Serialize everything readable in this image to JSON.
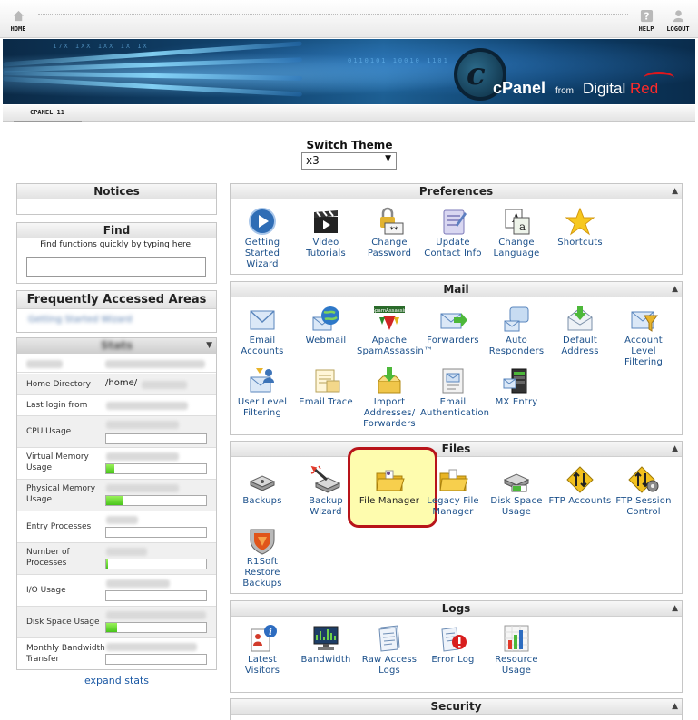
{
  "topnav": {
    "home": "HOME",
    "help": "HELP",
    "logout": "LOGOUT"
  },
  "banner": {
    "brand": "cPanel",
    "from": "from",
    "company_a": "Digital ",
    "company_b": "Red"
  },
  "subbar": {
    "label": "CPANEL 11"
  },
  "theme": {
    "label": "Switch Theme",
    "selected": "x3"
  },
  "notices": {
    "title": "Notices"
  },
  "find": {
    "title": "Find",
    "hint": "Find functions quickly by typing here.",
    "value": ""
  },
  "frequent": {
    "title": "Frequently Accessed Areas",
    "item": "Getting Started Wizard"
  },
  "stats": {
    "title": "Stats",
    "rows": [
      {
        "label": "Home Directory",
        "value": "/home/"
      },
      {
        "label": "Last login from"
      },
      {
        "label": "CPU Usage"
      },
      {
        "label": "Virtual Memory Usage",
        "fill": 0.08
      },
      {
        "label": "Physical Memory Usage",
        "fill": 0.16
      },
      {
        "label": "Entry Processes"
      },
      {
        "label": "Number of Processes",
        "fill": 0.02
      },
      {
        "label": "I/O Usage"
      },
      {
        "label": "Disk Space Usage",
        "fill": 0.11
      },
      {
        "label": "Monthly Bandwidth Transfer"
      }
    ],
    "expand": "expand stats"
  },
  "preferences": {
    "title": "Preferences",
    "items": [
      {
        "label": "Getting Started Wizard",
        "icon": "play-circle-icon"
      },
      {
        "label": "Video Tutorials",
        "icon": "clapperboard-icon"
      },
      {
        "label": "Change Password",
        "icon": "password-lock-icon"
      },
      {
        "label": "Update Contact Info",
        "icon": "contact-card-icon"
      },
      {
        "label": "Change Language",
        "icon": "language-icon"
      },
      {
        "label": "Shortcuts",
        "icon": "star-icon"
      }
    ]
  },
  "mail": {
    "title": "Mail",
    "items": [
      {
        "label": "Email Accounts",
        "icon": "envelope-icon"
      },
      {
        "label": "Webmail",
        "icon": "globe-mail-icon"
      },
      {
        "label": "Apache SpamAssassin™",
        "icon": "spamassassin-icon"
      },
      {
        "label": "Forwarders",
        "icon": "forward-mail-icon"
      },
      {
        "label": "Auto Responders",
        "icon": "auto-responder-icon"
      },
      {
        "label": "Default Address",
        "icon": "default-address-icon"
      },
      {
        "label": "Account Level Filtering",
        "icon": "filter-icon"
      },
      {
        "label": "User Level Filtering",
        "icon": "user-filter-icon"
      },
      {
        "label": "Email Trace",
        "icon": "trace-icon"
      },
      {
        "label": "Import Addresses/ Forwarders",
        "icon": "import-icon"
      },
      {
        "label": "Email Authentication",
        "icon": "authentication-icon"
      },
      {
        "label": "MX Entry",
        "icon": "mx-server-icon"
      }
    ]
  },
  "files": {
    "title": "Files",
    "items": [
      {
        "label": "Backups",
        "icon": "disk-drive-icon"
      },
      {
        "label": "Backup Wizard",
        "icon": "magic-wand-drive-icon"
      },
      {
        "label": "File Manager",
        "icon": "folder-icon"
      },
      {
        "label": "Legacy File Manager",
        "icon": "legacy-folder-icon"
      },
      {
        "label": "Disk Space Usage",
        "icon": "disk-usage-icon"
      },
      {
        "label": "FTP Accounts",
        "icon": "ftp-icon"
      },
      {
        "label": "FTP Session Control",
        "icon": "ftp-session-icon"
      },
      {
        "label": "R1Soft Restore Backups",
        "icon": "r1soft-icon"
      }
    ]
  },
  "logs": {
    "title": "Logs",
    "items": [
      {
        "label": "Latest Visitors",
        "icon": "visitors-icon"
      },
      {
        "label": "Bandwidth",
        "icon": "bandwidth-icon"
      },
      {
        "label": "Raw Access Logs",
        "icon": "raw-logs-icon"
      },
      {
        "label": "Error Log",
        "icon": "error-log-icon"
      },
      {
        "label": "Resource Usage",
        "icon": "resource-usage-icon"
      }
    ]
  },
  "security": {
    "title": "Security"
  },
  "colors": {
    "link": "#1a4f8a",
    "highlight_border": "#b8141a",
    "highlight_fill": "#fefcae",
    "bar_green": "#47c41a"
  }
}
